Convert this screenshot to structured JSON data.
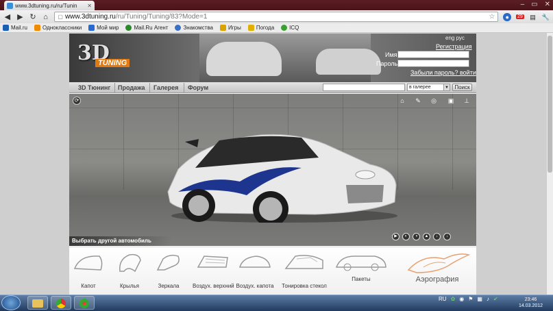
{
  "browser": {
    "tab_title": "www.3dtuning.ru/ru/Tunin",
    "url_host": "www.3dtuning.ru",
    "url_path": "/ru/Tuning/Tuning/83?Mode=1",
    "badge_count": "29"
  },
  "bookmarks": [
    {
      "label": "Mail.ru",
      "color": "#1a5fb4"
    },
    {
      "label": "Одноклассники",
      "color": "#f08a00"
    },
    {
      "label": "Мой мир",
      "color": "#2a6ad0"
    },
    {
      "label": "Mail.Ru Агент",
      "color": "#2a8a2a"
    },
    {
      "label": "Знакомства",
      "color": "#3a6fc8"
    },
    {
      "label": "Игры",
      "color": "#d9a400"
    },
    {
      "label": "Погода",
      "color": "#e0b000"
    },
    {
      "label": "ICQ",
      "color": "#3aa030"
    }
  ],
  "header": {
    "logo_3d": "3D",
    "logo_tuning": "TUNING",
    "lang": "eng рус",
    "register": "Регистрация",
    "name_label": "Имя",
    "password_label": "Пароль",
    "forgot": "Забыли пароль?",
    "login": "войти"
  },
  "menu": [
    "3D Тюнинг",
    "Продажа",
    "Галерея",
    "Форум"
  ],
  "search": {
    "scope": "в галерее",
    "button": "Поиск"
  },
  "viewer": {
    "pick_car": "Выбрать другой автомобиль"
  },
  "parts": [
    "Капот",
    "Крылья",
    "Зеркала",
    "Воздух. верхний",
    "Воздух. капота",
    "Тонировка стекол",
    "Пакеты"
  ],
  "airbrush": "Аэрография",
  "taskbar": {
    "lang": "RU",
    "time": "23:46",
    "date": "14.03.2012"
  }
}
